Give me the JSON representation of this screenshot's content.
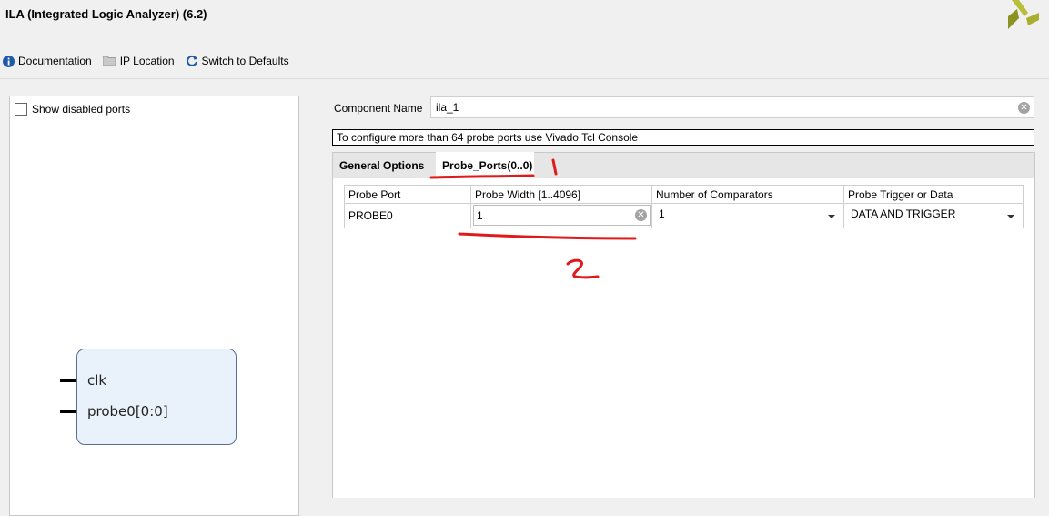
{
  "window": {
    "title": "ILA (Integrated Logic Analyzer) (6.2)"
  },
  "toolbar": {
    "documentation": "Documentation",
    "ip_location": "IP Location",
    "switch_defaults": "Switch to Defaults"
  },
  "left_panel": {
    "show_disabled_ports": "Show disabled ports",
    "symbol_pins": [
      "clk",
      "probe0[0:0]"
    ]
  },
  "component": {
    "label": "Component Name",
    "value": "ila_1"
  },
  "info_message": "To configure more than 64 probe ports use Vivado Tcl Console",
  "tabs": [
    {
      "label": "General Options"
    },
    {
      "label": "Probe_Ports(0..0)",
      "selected": true
    }
  ],
  "probe_table": {
    "headers": [
      "Probe Port",
      "Probe Width [1..4096]",
      "Number of Comparators",
      "Probe Trigger or Data"
    ],
    "rows": [
      {
        "port": "PROBE0",
        "width": "1",
        "comparators": "1",
        "trigger": "DATA AND TRIGGER"
      }
    ]
  },
  "annotations": [
    "1",
    "2"
  ],
  "colors": {
    "annotation": "#e01a1a",
    "logo": "#9aa21f",
    "info_icon": "#1f5aa6"
  }
}
